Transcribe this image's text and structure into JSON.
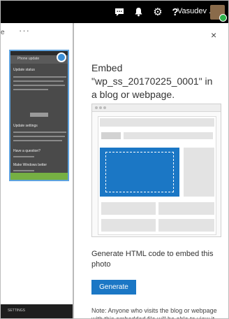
{
  "topbar": {
    "icons": [
      "chat-icon",
      "bell-icon",
      "gear-icon",
      "help-icon"
    ],
    "user_name": "Vasudev ."
  },
  "background": {
    "label": "e",
    "more": "···",
    "thumbnail": {
      "header": "Phone update",
      "heading1": "Update status",
      "heading2": "Update settings",
      "heading3": "Have a question?",
      "heading4": "Make Windows better"
    },
    "tray": "SETTINGS"
  },
  "panel": {
    "close": "×",
    "title": "Embed \"wp_ss_20170225_0001\" in a blog or webpage.",
    "generate_text": "Generate HTML code to embed this photo",
    "generate_button": "Generate",
    "note": "Note: Anyone who visits the blog or webpage with this embedded file will be able to view it without signing in."
  },
  "colors": {
    "accent": "#1b77c5",
    "topbar": "#000000"
  }
}
